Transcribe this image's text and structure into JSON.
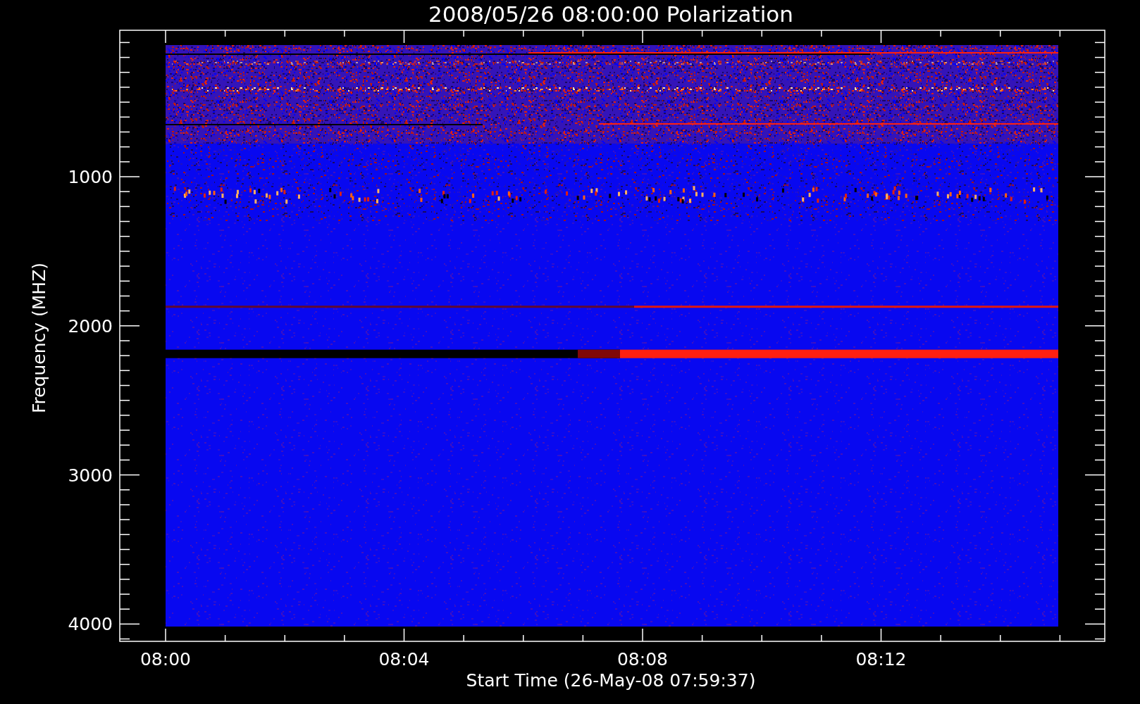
{
  "title": "2008/05/26 08:00:00 Polarization",
  "xlabel": "Start Time (26-May-08 07:59:37)",
  "ylabel": "Frequency (MHZ)",
  "xticks": [
    "08:00",
    "08:04",
    "08:08",
    "08:12"
  ],
  "yticks": [
    "1000",
    "2000",
    "3000",
    "4000"
  ]
}
